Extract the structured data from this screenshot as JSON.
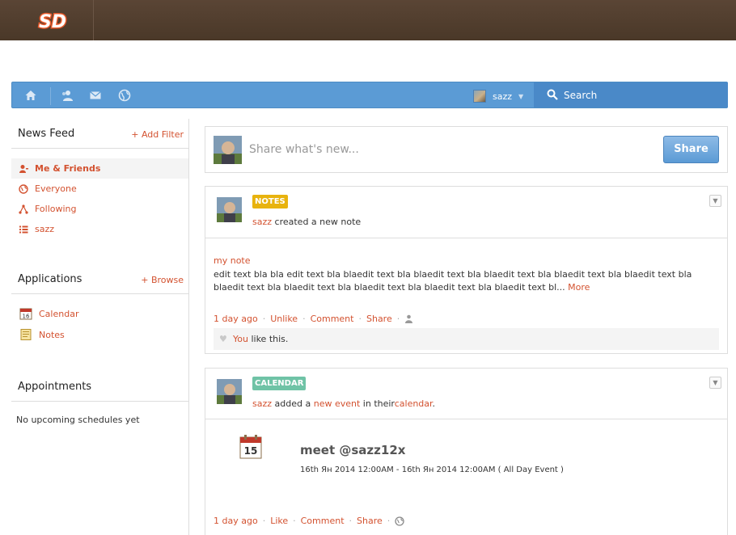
{
  "brand": {
    "logo_text": "SD",
    "logo_color": "#ea5a2b"
  },
  "toolbar": {
    "icons": [
      "home-icon",
      "friends-icon",
      "mail-icon",
      "globe-icon"
    ],
    "user_name": "sazz",
    "search_label": "Search",
    "accent": "#5b9bd5"
  },
  "sidebar": {
    "news_feed": {
      "title": "News Feed",
      "action": "+ Add Filter"
    },
    "filters": [
      {
        "label": "Me & Friends",
        "icon": "user-icon",
        "active": true
      },
      {
        "label": "Everyone",
        "icon": "globe-icon",
        "active": false
      },
      {
        "label": "Following",
        "icon": "share-icon",
        "active": false
      },
      {
        "label": "sazz",
        "icon": "list-icon",
        "active": false
      }
    ],
    "applications": {
      "title": "Applications",
      "action": "+ Browse"
    },
    "apps": [
      {
        "label": "Calendar",
        "icon": "calendar-icon"
      },
      {
        "label": "Notes",
        "icon": "notes-icon"
      }
    ],
    "appointments": {
      "title": "Appointments",
      "empty": "No upcoming schedules yet"
    }
  },
  "composer": {
    "placeholder": "Share what's new...",
    "button": "Share"
  },
  "stream": {
    "note": {
      "tag": "NOTES",
      "actor": "sazz",
      "action": "created a new note",
      "title": "my note",
      "body": "edit text bla bla edit text bla blaedit text bla blaedit text bla blaedit text bla blaedit text bla blaedit text bla blaedit text bla blaedit text bla blaedit text bla blaedit text bla blaedit text bl...",
      "more": "More",
      "time": "1 day ago",
      "actions": [
        "Unlike",
        "Comment",
        "Share"
      ],
      "like_who": "You",
      "like_text": "like this."
    },
    "calendar": {
      "tag": "CALENDAR",
      "actor": "sazz",
      "action_pre": "added a",
      "event_link": "new event",
      "action_mid": "in their",
      "app_link": "calendar",
      "action_end": ".",
      "day_number": "15",
      "event_title": "meet @sazz12x",
      "event_when": "16th Ян 2014 12:00AM - 16th Ян 2014 12:00AM ( All Day Event )",
      "time": "1 day ago",
      "actions": [
        "Like",
        "Comment",
        "Share"
      ]
    }
  }
}
